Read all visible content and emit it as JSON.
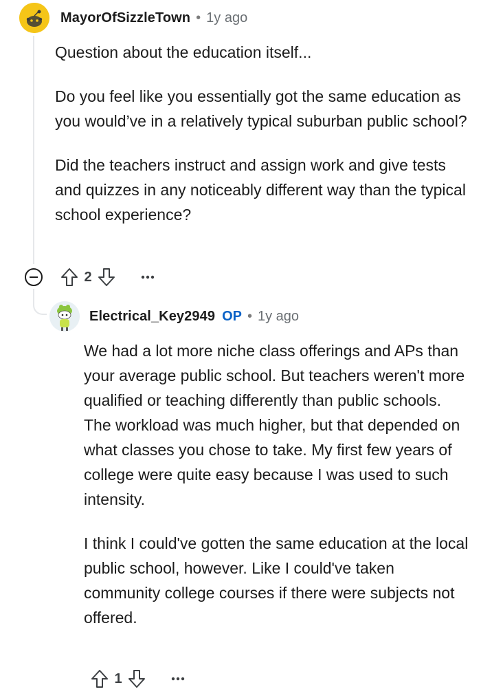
{
  "comment": {
    "username": "MayorOfSizzleTown",
    "separator": "•",
    "time": "1y ago",
    "paragraphs": [
      "Question about the education itself...",
      "Do you feel like you essentially got the same education as you would’ve in a relatively typical suburban public school?",
      "Did the teachers instruct and assign work and give tests and quizzes in any noticeably different way than the typical school experience?"
    ],
    "votes": "2"
  },
  "reply": {
    "username": "Electrical_Key2949",
    "badge": "OP",
    "separator": "•",
    "time": "1y ago",
    "paragraphs": [
      "We had a lot more niche class offerings and APs than your average public school. But teachers weren't more qualified or teaching differently than public schools. The workload was much higher, but that depended on what classes you chose to take. My first few years of college were quite easy because I was used to such intensity.",
      "I think I could've gotten the same education at the local public school, however. Like I could've taken community college courses if there were subjects not offered."
    ],
    "votes": "1"
  },
  "colors": {
    "avatar_yellow": "#f5c518",
    "op_blue": "#0a62c7",
    "thread_line": "#e5e7ea"
  }
}
